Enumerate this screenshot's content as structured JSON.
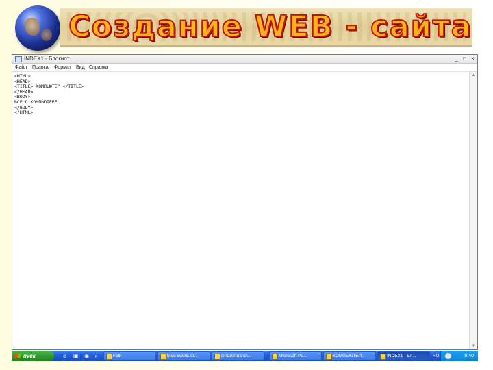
{
  "slide": {
    "title": "Создание WEB - сайта"
  },
  "window": {
    "title": "INDEX1 - Блокнот",
    "controls": {
      "minimize": "_",
      "maximize": "□",
      "close": "×"
    },
    "menu": [
      "Файл",
      "Правка",
      "Формат",
      "Вид",
      "Справка"
    ]
  },
  "editor": {
    "lines": [
      "<HTML>",
      "<HEAD>",
      "<TITLE> КОМПЬЮТЕР </TITLE>",
      "</HEAD>",
      "<BODY>",
      "ВСЕ О КОМПЬЮТЕРЕ",
      "</BODY>",
      "</HTML>"
    ]
  },
  "taskbar": {
    "start_label": "пуск",
    "tasks": [
      {
        "label": "Folk",
        "active": false
      },
      {
        "label": "Мой компьют...",
        "active": false
      },
      {
        "label": "D:\\Светлана\\...",
        "active": false
      },
      {
        "label": "Microsoft Po...",
        "active": false
      },
      {
        "label": "КОМПЬЮТЕР...",
        "active": false
      },
      {
        "label": "INDEX1 - Бл...",
        "active": true
      }
    ],
    "tray": {
      "lang": "RU",
      "clock": "9:40"
    }
  },
  "colors": {
    "title_fill": "#ffb31a",
    "title_outline": "#c0140c",
    "taskbar": "#245edb",
    "start": "#2f9a2a"
  }
}
